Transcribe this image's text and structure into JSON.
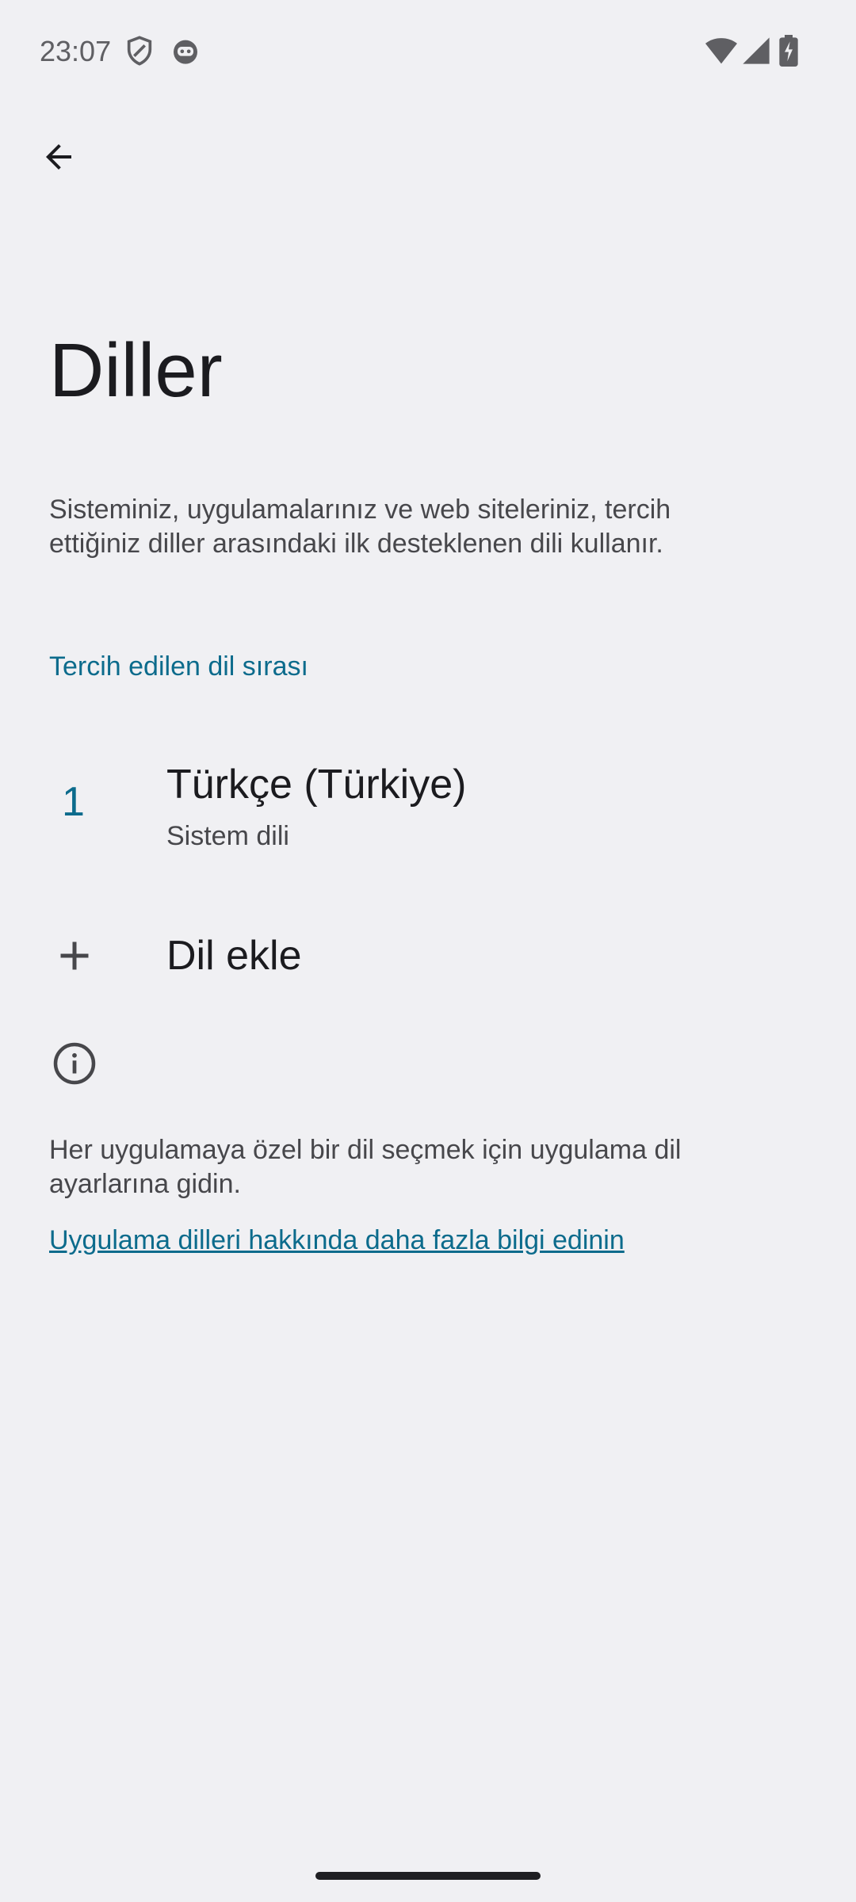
{
  "status_bar": {
    "time": "23:07",
    "icons": [
      "shield-icon",
      "android-icon",
      "wifi-icon",
      "signal-icon",
      "battery-charging-icon"
    ]
  },
  "toolbar": {
    "back_icon": "arrow-back-icon"
  },
  "page": {
    "title": "Diller",
    "description": "Sisteminiz, uygulamalarınız ve web siteleriniz, tercih ettiğiniz diller arasındaki ilk desteklenen dili kullanır."
  },
  "section": {
    "header": "Tercih edilen dil sırası"
  },
  "languages": [
    {
      "index": "1",
      "name": "Türkçe (Türkiye)",
      "summary": "Sistem dili"
    }
  ],
  "add_language": {
    "label": "Dil ekle",
    "icon": "plus-icon"
  },
  "footer": {
    "info_icon": "info-icon",
    "text": "Her uygulamaya özel bir dil seçmek için uygulama dil ayarlarına gidin.",
    "link": "Uygulama dilleri hakkında daha fazla bilgi edinin"
  },
  "colors": {
    "accent": "#0c6b8c",
    "background": "#f0f0f3",
    "text_primary": "#1b1b1f",
    "text_secondary": "#47474b"
  }
}
